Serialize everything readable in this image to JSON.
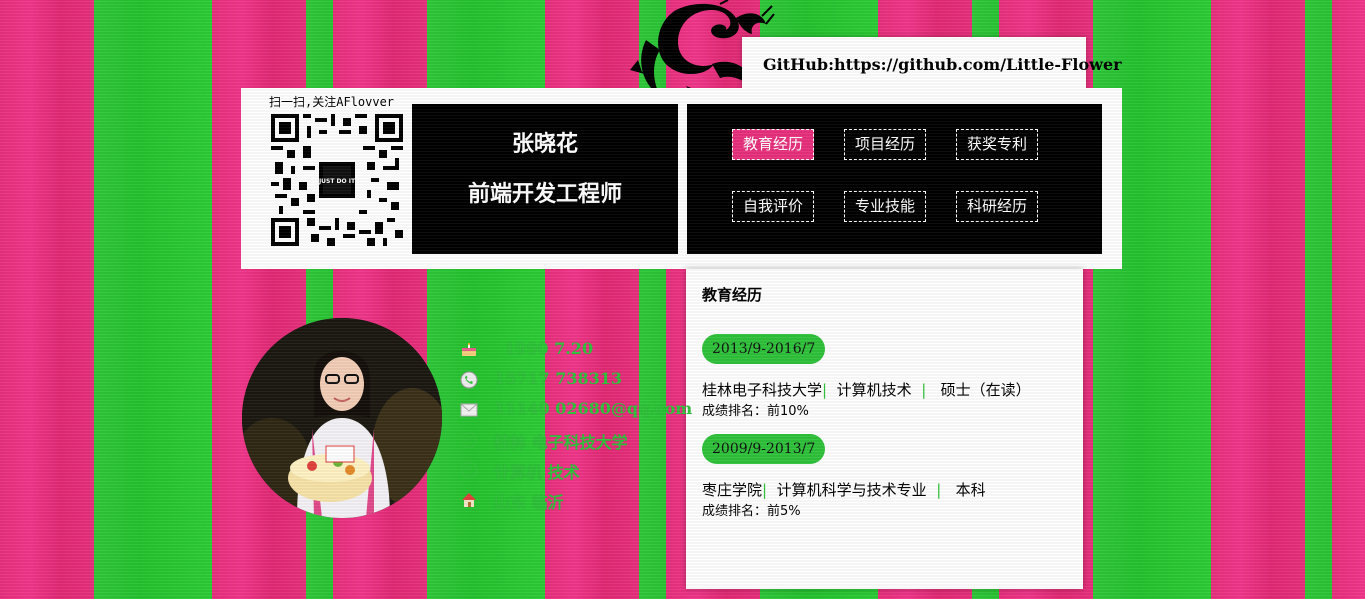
{
  "github": {
    "text": "GitHub:https://github.com/Little-Flower"
  },
  "qr": {
    "caption": "扫一扫,关注AFlovver",
    "center_label": "JUST DO IT"
  },
  "profile": {
    "name": "张晓花",
    "role": "前端开发工程师"
  },
  "nav": {
    "items": [
      {
        "label": "教育经历",
        "active": true
      },
      {
        "label": "项目经历",
        "active": false
      },
      {
        "label": "获奖专利",
        "active": false
      },
      {
        "label": "自我评价",
        "active": false
      },
      {
        "label": "专业技能",
        "active": false
      },
      {
        "label": "科研经历",
        "active": false
      }
    ]
  },
  "education": {
    "title": "教育经历",
    "entries": [
      {
        "period": "2013/9-2016/7",
        "school": "桂林电子科技大学",
        "major": "计算机技术",
        "degree": "硕士（在读）",
        "rank": "成绩排名：前10%"
      },
      {
        "period": "2009/9-2013/7",
        "school": "枣庄学院",
        "major": "计算机科学与技术专业",
        "degree": "本科",
        "rank": "成绩排名：前5%"
      }
    ],
    "separator": "|"
  },
  "info": {
    "birthday": "1990  7.20",
    "phone": "15717 738313",
    "email": "11140 02680@qq.com",
    "school": "桂林   电子科技大学",
    "major": "计算机  技术",
    "location": "山东   临沂"
  },
  "colors": {
    "pink": "#e8307d",
    "green": "#2fc23a",
    "black": "#000000",
    "white": "#ffffff"
  },
  "icons": [
    "cake-icon",
    "phone-icon",
    "email-icon",
    "school-icon",
    "major-icon",
    "home-icon"
  ]
}
